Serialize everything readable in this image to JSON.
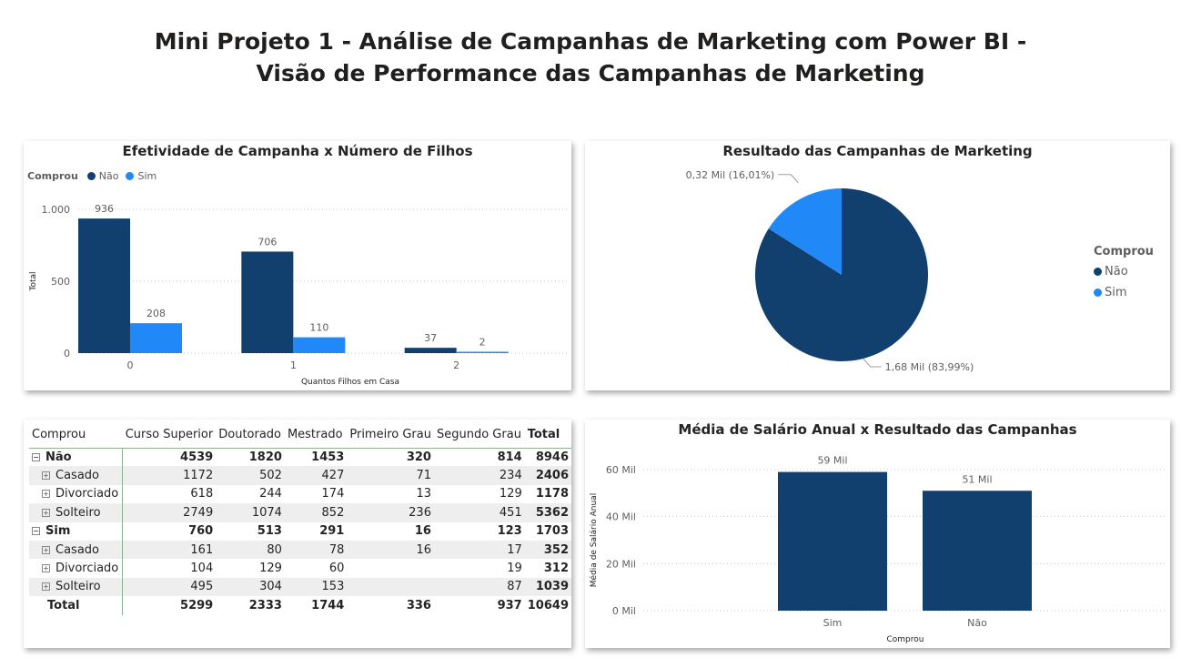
{
  "page": {
    "title_line1": "Mini Projeto 1 - Análise de Campanhas de Marketing com Power BI -",
    "title_line2": "Visão de Performance das Campanhas de Marketing"
  },
  "colors": {
    "nao": "#12406e",
    "sim": "#2188f7",
    "grid": "#c8c6c4"
  },
  "chart_data": [
    {
      "type": "bar",
      "title": "Efetividade de Campanha x Número de Filhos",
      "legend_title": "Comprou",
      "legend_placement": "top-left",
      "categories": [
        "0",
        "1",
        "2"
      ],
      "series": [
        {
          "name": "Não",
          "values": [
            936,
            706,
            37
          ],
          "labels": [
            "936",
            "706",
            "37"
          ]
        },
        {
          "name": "Sim",
          "values": [
            208,
            110,
            2
          ],
          "labels": [
            "208",
            "110",
            "2"
          ]
        }
      ],
      "xlabel": "Quantos Filhos em Casa",
      "ylabel": "Total",
      "yticks": [
        0,
        500,
        1000
      ],
      "ytick_labels": [
        "0",
        "500",
        "1.000"
      ],
      "ylim": [
        0,
        1000
      ],
      "grid": true
    },
    {
      "type": "pie",
      "title": "Resultado das Campanhas de Marketing",
      "legend_title": "Comprou",
      "legend_placement": "right",
      "slices": [
        {
          "name": "Não",
          "value": 1.68,
          "share": 83.99,
          "label": "1,68 Mil (83,99%)"
        },
        {
          "name": "Sim",
          "value": 0.32,
          "share": 16.01,
          "label": "0,32 Mil (16,01%)"
        }
      ]
    },
    {
      "type": "bar",
      "title": "Média de Salário Anual x Resultado das Campanhas",
      "categories": [
        "Sim",
        "Não"
      ],
      "values": [
        59,
        51
      ],
      "labels": [
        "59 Mil",
        "51 Mil"
      ],
      "xlabel": "Comprou",
      "ylabel": "Média de Salário Anual",
      "yticks": [
        0,
        20,
        40,
        60
      ],
      "ytick_labels": [
        "0 Mil",
        "20 Mil",
        "40 Mil",
        "60 Mil"
      ],
      "ylim": [
        0,
        60
      ],
      "grid": true
    },
    {
      "type": "table",
      "columns": [
        "Comprou",
        "Curso Superior",
        "Doutorado",
        "Mestrado",
        "Primeiro Grau",
        "Segundo Grau",
        "Total"
      ],
      "rows": [
        {
          "kind": "group",
          "label": "Não",
          "values": [
            "4539",
            "1820",
            "1453",
            "320",
            "814",
            "8946"
          ]
        },
        {
          "kind": "child",
          "label": "Casado",
          "values": [
            "1172",
            "502",
            "427",
            "71",
            "234",
            "2406"
          ]
        },
        {
          "kind": "child",
          "label": "Divorciado",
          "values": [
            "618",
            "244",
            "174",
            "13",
            "129",
            "1178"
          ]
        },
        {
          "kind": "child",
          "label": "Solteiro",
          "values": [
            "2749",
            "1074",
            "852",
            "236",
            "451",
            "5362"
          ]
        },
        {
          "kind": "group",
          "label": "Sim",
          "values": [
            "760",
            "513",
            "291",
            "16",
            "123",
            "1703"
          ]
        },
        {
          "kind": "child",
          "label": "Casado",
          "values": [
            "161",
            "80",
            "78",
            "16",
            "17",
            "352"
          ]
        },
        {
          "kind": "child",
          "label": "Divorciado",
          "values": [
            "104",
            "129",
            "60",
            "",
            "19",
            "312"
          ]
        },
        {
          "kind": "child",
          "label": "Solteiro",
          "values": [
            "495",
            "304",
            "153",
            "",
            "87",
            "1039"
          ]
        },
        {
          "kind": "total",
          "label": "Total",
          "values": [
            "5299",
            "2333",
            "1744",
            "336",
            "937",
            "10649"
          ]
        }
      ]
    }
  ]
}
